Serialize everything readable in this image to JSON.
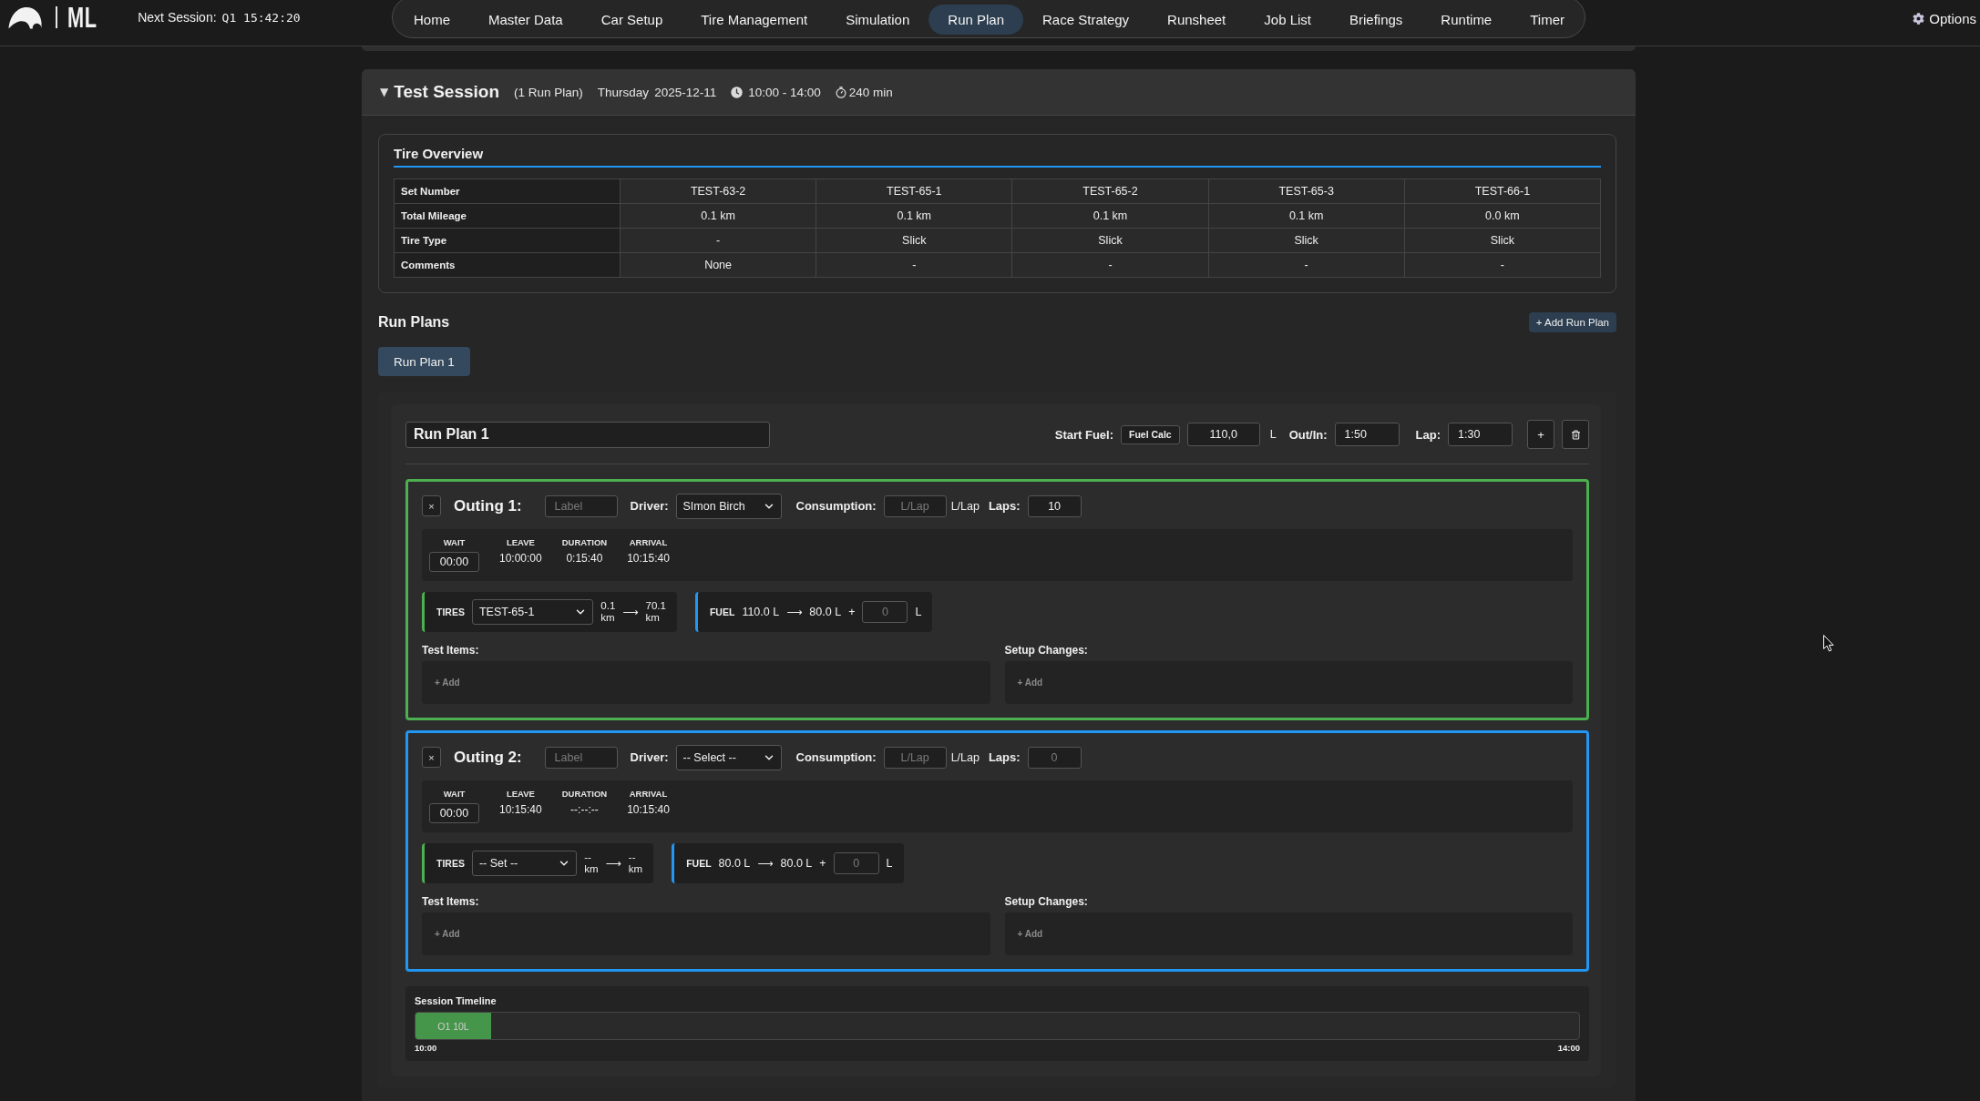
{
  "top_bar": {
    "logo_text": "ML",
    "next_session_label": "Next Session:",
    "next_session_value": "Q1 15:42:20",
    "nav": [
      {
        "label": "Home",
        "selected": false
      },
      {
        "label": "Master Data",
        "selected": false
      },
      {
        "label": "Car Setup",
        "selected": false
      },
      {
        "label": "Tire Management",
        "selected": false
      },
      {
        "label": "Simulation",
        "selected": false
      },
      {
        "label": "Run Plan",
        "selected": true
      },
      {
        "label": "Race Strategy",
        "selected": false
      },
      {
        "label": "Runsheet",
        "selected": false
      },
      {
        "label": "Job List",
        "selected": false
      },
      {
        "label": "Briefings",
        "selected": false
      },
      {
        "label": "Runtime",
        "selected": false
      },
      {
        "label": "Timer",
        "selected": false
      }
    ],
    "options": "Options"
  },
  "session": {
    "toggle": "▼",
    "title": "Test Session",
    "run_plan_count": "(1 Run Plan)",
    "weekday": "Thursday",
    "date": "2025-12-11",
    "time_range": "10:00 - 14:00",
    "duration": "240 min"
  },
  "tire_overview": {
    "title": "Tire Overview",
    "rows": [
      {
        "label": "Set Number",
        "cells": [
          "TEST-63-2",
          "TEST-65-1",
          "TEST-65-2",
          "TEST-65-3",
          "TEST-66-1"
        ]
      },
      {
        "label": "Total Mileage",
        "cells": [
          "0.1 km",
          "0.1 km",
          "0.1 km",
          "0.1 km",
          "0.0 km"
        ]
      },
      {
        "label": "Tire Type",
        "cells": [
          "-",
          "Slick",
          "Slick",
          "Slick",
          "Slick"
        ]
      },
      {
        "label": "Comments",
        "cells": [
          "None",
          "-",
          "-",
          "-",
          "-"
        ]
      }
    ]
  },
  "run_plans": {
    "title": "Run Plans",
    "add_button": "+ Add Run Plan",
    "tabs": [
      {
        "label": "Run Plan 1",
        "selected": true
      }
    ]
  },
  "run_plan": {
    "name": "Run Plan 1",
    "start_fuel_label": "Start Fuel:",
    "fuel_calc_button": "Fuel Calc",
    "start_fuel": "110,0",
    "start_fuel_unit": "L",
    "out_in_label": "Out/In:",
    "out_in": "1:50",
    "lap_label": "Lap:",
    "lap": "1:30",
    "add_button": "+"
  },
  "outings": [
    {
      "color": "#4caf50",
      "close": "×",
      "title": "Outing 1:",
      "label_placeholder": "Label",
      "driver_label": "Driver:",
      "driver": "SImon Birch",
      "consumption_label": "Consumption:",
      "consumption_placeholder": "L/Lap",
      "consumption_unit": "L/Lap",
      "laps_label": "Laps:",
      "laps": {
        "value": "10"
      },
      "times": [
        {
          "kind": "input",
          "label": "WAIT",
          "value": "00:00"
        },
        {
          "kind": "text",
          "label": "LEAVE",
          "value": "10:00:00"
        },
        {
          "kind": "text",
          "label": "DURATION",
          "value": "0:15:40"
        },
        {
          "kind": "text",
          "label": "ARRIVAL",
          "value": "10:15:40"
        }
      ],
      "tires": {
        "label": "TIRES",
        "set": "TEST-65-1",
        "from": "0.1 km",
        "arrow": "⟶",
        "to": "70.1 km"
      },
      "fuel": {
        "label": "FUEL",
        "from": "110.0 L",
        "arrow": "⟶",
        "to": "80.0 L",
        "plus": "+",
        "added_placeholder": "0",
        "unit": "L"
      },
      "test_items": {
        "label": "Test Items:",
        "add": "+ Add"
      },
      "setup_changes": {
        "label": "Setup Changes:",
        "add": "+ Add"
      }
    },
    {
      "color": "#2196f3",
      "close": "×",
      "title": "Outing 2:",
      "label_placeholder": "Label",
      "driver_label": "Driver:",
      "driver": "-- Select --",
      "consumption_label": "Consumption:",
      "consumption_placeholder": "L/Lap",
      "consumption_unit": "L/Lap",
      "laps_label": "Laps:",
      "laps": {
        "placeholder": "0"
      },
      "times": [
        {
          "kind": "input",
          "label": "WAIT",
          "value": "00:00"
        },
        {
          "kind": "text",
          "label": "LEAVE",
          "value": "10:15:40"
        },
        {
          "kind": "text",
          "label": "DURATION",
          "value": "--:--:--"
        },
        {
          "kind": "text",
          "label": "ARRIVAL",
          "value": "10:15:40"
        }
      ],
      "tires": {
        "label": "TIRES",
        "set": "-- Set --",
        "from": "-- km",
        "arrow": "⟶",
        "to": "-- km"
      },
      "fuel": {
        "label": "FUEL",
        "from": "80.0 L",
        "arrow": "⟶",
        "to": "80.0 L",
        "plus": "+",
        "added_placeholder": "0",
        "unit": "L"
      },
      "test_items": {
        "label": "Test Items:",
        "add": "+ Add"
      },
      "setup_changes": {
        "label": "Setup Changes:",
        "add": "+ Add"
      }
    }
  ],
  "timeline": {
    "title": "Session Timeline",
    "segments": [
      {
        "label": "O1 10L",
        "level": 0.065
      }
    ],
    "start": "10:00",
    "end": "14:00"
  }
}
